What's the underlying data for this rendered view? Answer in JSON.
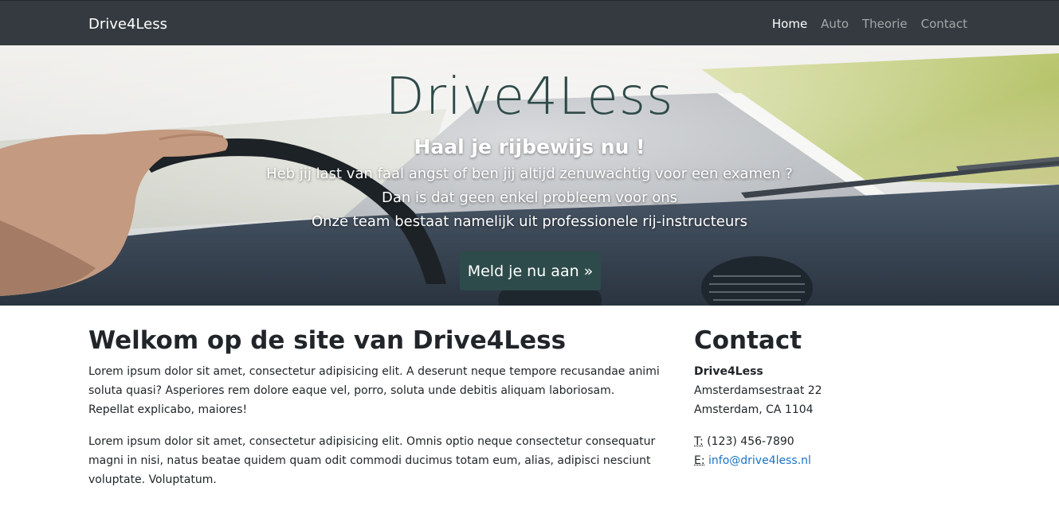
{
  "navbar": {
    "brand": "Drive4Less",
    "links": [
      {
        "label": "Home",
        "active": true
      },
      {
        "label": "Auto",
        "active": false
      },
      {
        "label": "Theorie",
        "active": false
      },
      {
        "label": "Contact",
        "active": false
      }
    ]
  },
  "hero": {
    "title": "Drive4Less",
    "subtitle": "Haal je rijbewijs nu !",
    "lines": [
      "Heb jij last van faal angst of ben jij altijd zenuwachtig voor een examen ?",
      "Dan is dat geen enkel probleem voor ons",
      "Onze team bestaat namelijk uit professionele rij-instructeurs"
    ],
    "cta_label": "Meld je nu aan »"
  },
  "main": {
    "heading": "Welkom op de site van Drive4Less",
    "paragraphs": [
      "Lorem ipsum dolor sit amet, consectetur adipisicing elit. A deserunt neque tempore recusandae animi soluta quasi? Asperiores rem dolore eaque vel, porro, soluta unde debitis aliquam laboriosam. Repellat explicabo, maiores!",
      "Lorem ipsum dolor sit amet, consectetur adipisicing elit. Omnis optio neque consectetur consequatur magni in nisi, natus beatae quidem quam odit commodi ducimus totam eum, alias, adipisci nesciunt voluptate. Voluptatum."
    ]
  },
  "contact": {
    "heading": "Contact",
    "company": "Drive4Less",
    "street": "Amsterdamsestraat 22",
    "city": "Amsterdam, CA 1104",
    "phone_label": "T:",
    "phone": "(123) 456-7890",
    "email_label": "E:",
    "email": "info@drive4less.nl"
  },
  "colors": {
    "navbar_bg": "#343a40",
    "cta_bg": "#2d4b4a",
    "hero_title": "#2e4a48",
    "link": "#1a73c8"
  }
}
